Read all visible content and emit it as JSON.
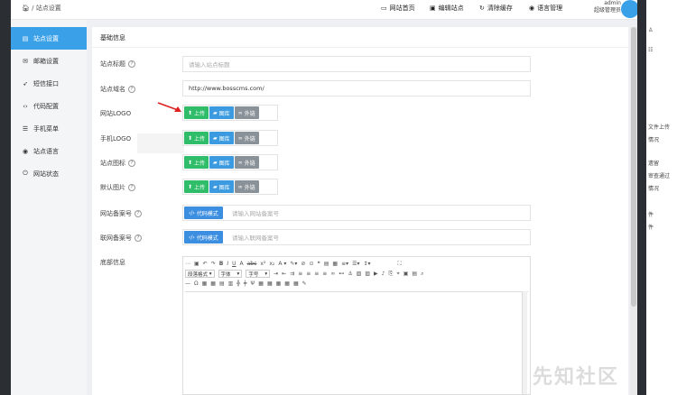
{
  "header": {
    "breadcrumb": "/ 站点设置",
    "nav": [
      {
        "icon": "monitor-icon",
        "label": "网站首页"
      },
      {
        "icon": "edit-icon",
        "label": "编辑站点"
      },
      {
        "icon": "refresh-icon",
        "label": "清除缓存"
      },
      {
        "icon": "globe-icon",
        "label": "语言管理"
      }
    ],
    "user_name": "admin",
    "user_role": "超级管理员"
  },
  "sidebar": {
    "items": [
      {
        "label": "站点设置",
        "icon": "grid-icon",
        "active": true
      },
      {
        "label": "邮箱设置",
        "icon": "mail-icon",
        "active": false
      },
      {
        "label": "短信接口",
        "icon": "send-icon",
        "active": false
      },
      {
        "label": "代码配置",
        "icon": "code-icon",
        "active": false
      },
      {
        "label": "手机菜单",
        "icon": "list-icon",
        "active": false
      },
      {
        "label": "站点语言",
        "icon": "globe-icon",
        "active": false
      },
      {
        "label": "网站状态",
        "icon": "power-icon",
        "active": false
      }
    ]
  },
  "form": {
    "section_title": "基础信息",
    "site_title": {
      "label": "站点标题",
      "placeholder": "请输入站点标题"
    },
    "site_domain": {
      "label": "站点域名",
      "value": "http://www.bosscms.com/"
    },
    "site_logo": {
      "label": "网站LOGO"
    },
    "mobile_logo": {
      "label": "手机LOGO"
    },
    "site_icon": {
      "label": "站点图标"
    },
    "default_image": {
      "label": "默认图片"
    },
    "icp": {
      "label": "网站备案号",
      "mode": "代码模式",
      "placeholder": "请输入网站备案号"
    },
    "police": {
      "label": "联网备案号",
      "mode": "代码模式",
      "placeholder": "请输入联网备案号"
    },
    "footer": {
      "label": "底部信息"
    },
    "btn_upload": "上传",
    "btn_gallery": "图库",
    "btn_external": "外链"
  },
  "editor": {
    "font_style": "段落格式",
    "font_family": "字体",
    "font_size": "字号"
  },
  "right_panel": [
    "文件上传",
    "情况",
    "",
    "遗留",
    "审查通过",
    "情况",
    "件",
    "件"
  ],
  "watermark": "先知社区",
  "colors": {
    "primary": "#3aa0e8",
    "upload_green": "#2fbd6a",
    "gallery_blue": "#3c9be0",
    "external_gray": "#8a9299"
  }
}
